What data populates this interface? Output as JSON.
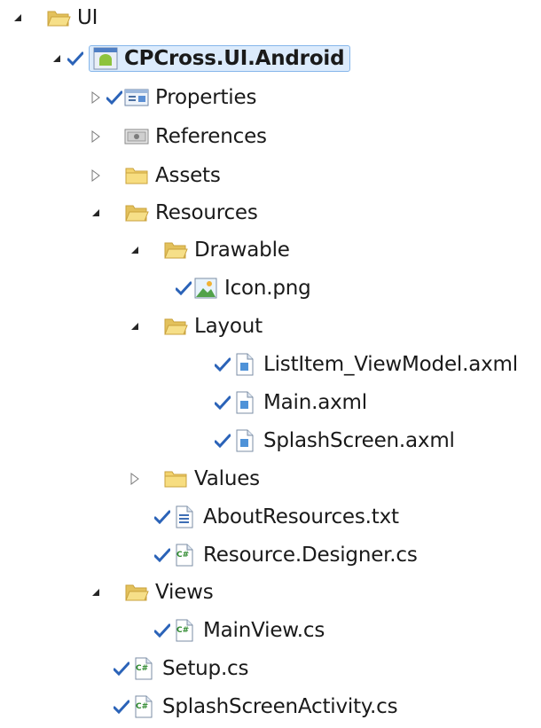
{
  "tree": {
    "root": {
      "label": "UI",
      "icon": "folder-open-icon"
    },
    "project": {
      "label": "CPCross.UI.Android",
      "icon": "android-project-icon"
    },
    "properties": {
      "label": "Properties",
      "icon": "properties-icon"
    },
    "references": {
      "label": "References",
      "icon": "references-icon"
    },
    "assets": {
      "label": "Assets",
      "icon": "folder-icon"
    },
    "resources": {
      "label": "Resources",
      "icon": "folder-open-icon"
    },
    "drawable": {
      "label": "Drawable",
      "icon": "folder-open-icon"
    },
    "icon_png": {
      "label": "Icon.png",
      "icon": "image-file-icon"
    },
    "layout": {
      "label": "Layout",
      "icon": "folder-open-icon"
    },
    "listitem": {
      "label": "ListItem_ViewModel.axml",
      "icon": "axml-file-icon"
    },
    "main_axml": {
      "label": "Main.axml",
      "icon": "axml-file-icon"
    },
    "splash_axml": {
      "label": "SplashScreen.axml",
      "icon": "axml-file-icon"
    },
    "values": {
      "label": "Values",
      "icon": "folder-icon"
    },
    "about": {
      "label": "AboutResources.txt",
      "icon": "text-file-icon"
    },
    "designer": {
      "label": "Resource.Designer.cs",
      "icon": "csharp-file-icon"
    },
    "views": {
      "label": "Views",
      "icon": "folder-open-icon"
    },
    "mainview": {
      "label": "MainView.cs",
      "icon": "csharp-file-icon"
    },
    "setup": {
      "label": "Setup.cs",
      "icon": "csharp-file-icon"
    },
    "splash_activity": {
      "label": "SplashScreenActivity.cs",
      "icon": "csharp-file-icon"
    }
  },
  "colors": {
    "selection_background": "#dcebfc",
    "selection_border": "#86b6ea",
    "check_blue": "#2b63b8",
    "folder_yellow": "#f3d36e",
    "csharp_green": "#2f8a2f"
  }
}
